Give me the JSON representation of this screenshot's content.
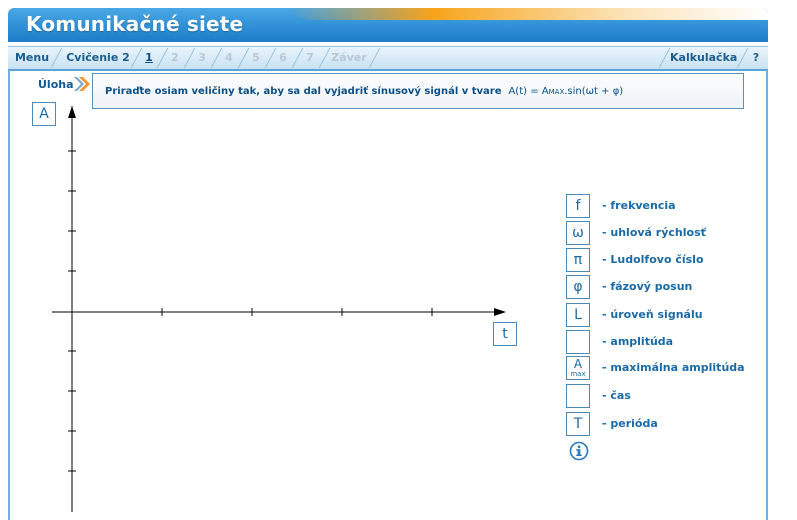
{
  "app": {
    "title": "Komunikačné siete"
  },
  "nav": {
    "menu": "Menu",
    "exercise": "Cvičenie 2",
    "steps": [
      "1",
      "2",
      "3",
      "4",
      "5",
      "6",
      "7"
    ],
    "end": "Záver",
    "calculator": "Kalkulačka",
    "help": "?"
  },
  "task": {
    "label": "Úloha",
    "text": "Priraďte osiam veličiny tak, aby sa dal vyjadriť sínusový signál v tvare",
    "formula_a": "A(t) = A",
    "formula_sub": "MAX",
    "formula_b": ".sin(ωt + φ)"
  },
  "axes": {
    "y_slot": "A",
    "x_slot": "t"
  },
  "legend": [
    {
      "symbol": "f",
      "label": "- frekvencia"
    },
    {
      "symbol": "ω",
      "label": "- uhlová rýchlosť"
    },
    {
      "symbol": "π",
      "label": "- Ludolfovo číslo"
    },
    {
      "symbol": "φ",
      "label": "- fázový posun"
    },
    {
      "symbol": "L",
      "label": "- úroveň signálu"
    },
    {
      "symbol": "",
      "label": "- amplitúda"
    },
    {
      "symbol": "A",
      "symbol_sub": "max",
      "label": "- maximálna amplitúda"
    },
    {
      "symbol": "",
      "label": "- čas"
    },
    {
      "symbol": "T",
      "label": "- perióda"
    }
  ],
  "colors": {
    "header": "#1b7cc8",
    "accent": "#f7a31b",
    "text": "#1a6aa6",
    "dim": "#b8c9d6"
  }
}
